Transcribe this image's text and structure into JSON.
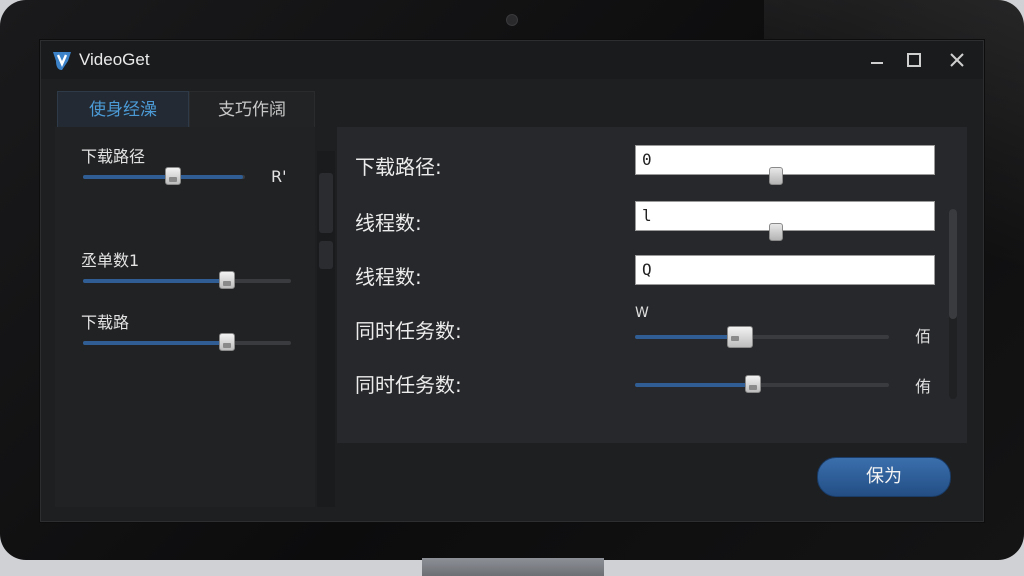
{
  "window": {
    "title": "VideoGet"
  },
  "tabs": [
    {
      "label": "使身经澡",
      "active": true
    },
    {
      "label": "支巧作阔",
      "active": false
    }
  ],
  "left_panel": {
    "items": [
      {
        "label": "下载路径",
        "slider_value": 0.45,
        "extra": "R'"
      },
      {
        "label": "丞单数1",
        "slider_value": 0.69,
        "extra": ""
      },
      {
        "label": "下载路",
        "slider_value": 0.69,
        "extra": ""
      }
    ]
  },
  "right_panel": {
    "fields": [
      {
        "label": "下载路径:",
        "value": "0"
      },
      {
        "label": "线程数:",
        "value": "l"
      },
      {
        "label": "线程数:",
        "value": "Q"
      }
    ],
    "sliders": [
      {
        "label": "同时任务数:",
        "top_label": "W",
        "side_label": "佰",
        "value": 0.41
      },
      {
        "label": "同时任务数:",
        "top_label": "",
        "side_label": "侑",
        "value": 0.47
      }
    ]
  },
  "footer": {
    "save_label": "保为"
  },
  "colors": {
    "accent": "#4b9ad6",
    "slider_fill": "#2f5d94",
    "button": "#2b5c96",
    "window_bg": "#1e1f21"
  }
}
